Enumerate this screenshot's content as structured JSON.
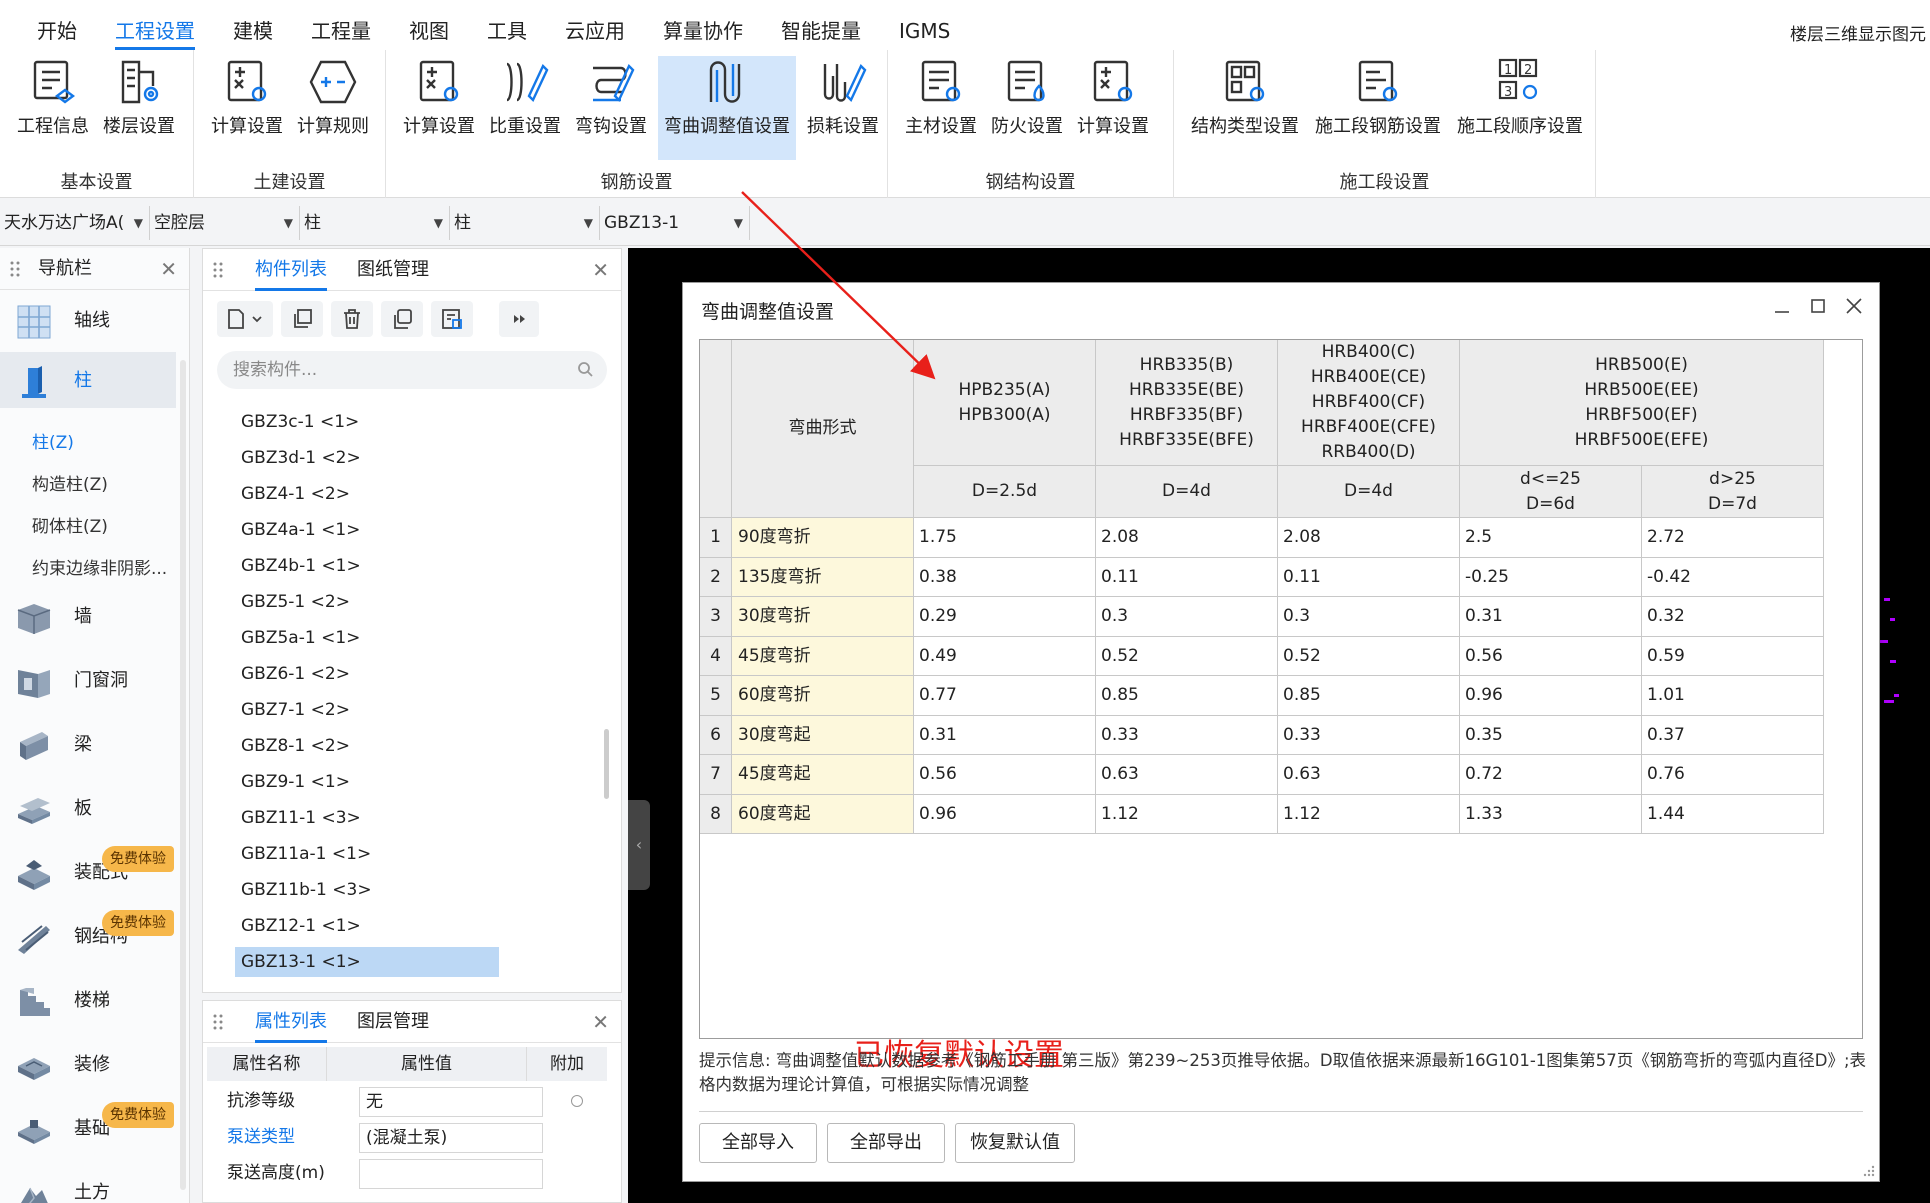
{
  "menubar": {
    "items": [
      "开始",
      "工程设置",
      "建模",
      "工程量",
      "视图",
      "工具",
      "云应用",
      "算量协作",
      "智能提量",
      "IGMS"
    ],
    "active_index": 1,
    "right_text": "楼层三维显示图元"
  },
  "ribbon": {
    "groups": {
      "basic": {
        "label": "基本设置",
        "btn0": "工程信息",
        "btn1": "楼层设置"
      },
      "civil": {
        "label": "土建设置",
        "btn0": "计算设置",
        "btn1": "计算规则"
      },
      "rebar": {
        "label": "钢筋设置",
        "btn0": "计算设置",
        "btn1": "比重设置",
        "btn2": "弯钩设置",
        "btn3": "弯曲调整值设置",
        "btn4": "损耗设置"
      },
      "steel": {
        "label": "钢结构设置",
        "btn0": "主材设置",
        "btn1": "防火设置",
        "btn2": "计算设置"
      },
      "stage": {
        "label": "施工段设置",
        "btn0": "结构类型设置",
        "btn1": "施工段钢筋设置",
        "btn2": "施工段顺序设置"
      }
    }
  },
  "selectors": {
    "project": "天水万达广场A(",
    "floor": "空腔层",
    "category": "柱",
    "type": "柱",
    "element": "GBZ13-1"
  },
  "nav": {
    "title": "导航栏",
    "items": {
      "axis": "轴线",
      "column": "柱",
      "wall": "墙",
      "opening": "门窗洞",
      "beam": "梁",
      "slab": "板",
      "prefab": "装配式",
      "steel": "钢结构",
      "stair": "楼梯",
      "decor": "装修",
      "foundation": "基础",
      "earth": "土方"
    },
    "subitems": [
      "柱(Z)",
      "构造柱(Z)",
      "砌体柱(Z)",
      "约束边缘非阴影..."
    ],
    "badge": "免费体验"
  },
  "components": {
    "tab_list": "构件列表",
    "tab_drawings": "图纸管理",
    "search_placeholder": "搜索构件...",
    "rows": [
      "GBZ3c-1 <1>",
      "GBZ3d-1 <2>",
      "GBZ4-1 <2>",
      "GBZ4a-1 <1>",
      "GBZ4b-1 <1>",
      "GBZ5-1 <2>",
      "GBZ5a-1 <1>",
      "GBZ6-1 <2>",
      "GBZ7-1 <2>",
      "GBZ8-1 <2>",
      "GBZ9-1 <1>",
      "GBZ11-1 <3>",
      "GBZ11a-1 <1>",
      "GBZ11b-1 <3>",
      "GBZ12-1 <1>",
      "GBZ13-1 <1>"
    ],
    "selected_index": 15
  },
  "properties": {
    "tab_list": "属性列表",
    "tab_layers": "图层管理",
    "col_name": "属性名称",
    "col_value": "属性值",
    "col_extra": "附加",
    "rows": [
      {
        "name": "抗渗等级",
        "value": "无"
      },
      {
        "name": "泵送类型",
        "value": "(混凝土泵)"
      },
      {
        "name": "泵送高度(m)",
        "value": ""
      }
    ]
  },
  "dialog": {
    "title": "弯曲调整值设置",
    "header": {
      "shape": "弯曲形式",
      "g1": [
        "HPB235(A)",
        "HPB300(A)"
      ],
      "g2": [
        "HRB335(B)",
        "HRB335E(BE)",
        "HRBF335(BF)",
        "HRBF335E(BFE)"
      ],
      "g3": [
        "HRB400(C)",
        "HRB400E(CE)",
        "HRBF400(CF)",
        "HRBF400E(CFE)",
        "RRB400(D)"
      ],
      "g4": [
        "HRB500(E)",
        "HRB500E(EE)",
        "HRBF500(EF)",
        "HRBF500E(EFE)"
      ],
      "d1": [
        "D=2.5d"
      ],
      "d2": [
        "D=4d"
      ],
      "d3": [
        "D=4d"
      ],
      "d4a": [
        "d<=25",
        "D=6d"
      ],
      "d4b": [
        "d>25",
        "D=7d"
      ]
    },
    "rows": [
      {
        "no": "1",
        "name": "90度弯折",
        "v": [
          "1.75",
          "2.08",
          "2.08",
          "2.5",
          "2.72"
        ]
      },
      {
        "no": "2",
        "name": "135度弯折",
        "v": [
          "0.38",
          "0.11",
          "0.11",
          "-0.25",
          "-0.42"
        ]
      },
      {
        "no": "3",
        "name": "30度弯折",
        "v": [
          "0.29",
          "0.3",
          "0.3",
          "0.31",
          "0.32"
        ]
      },
      {
        "no": "4",
        "name": "45度弯折",
        "v": [
          "0.49",
          "0.52",
          "0.52",
          "0.56",
          "0.59"
        ]
      },
      {
        "no": "5",
        "name": "60度弯折",
        "v": [
          "0.77",
          "0.85",
          "0.85",
          "0.96",
          "1.01"
        ]
      },
      {
        "no": "6",
        "name": "30度弯起",
        "v": [
          "0.31",
          "0.33",
          "0.33",
          "0.35",
          "0.37"
        ]
      },
      {
        "no": "7",
        "name": "45度弯起",
        "v": [
          "0.56",
          "0.63",
          "0.63",
          "0.72",
          "0.76"
        ]
      },
      {
        "no": "8",
        "name": "60度弯起",
        "v": [
          "0.96",
          "1.12",
          "1.12",
          "1.33",
          "1.44"
        ]
      }
    ],
    "restored_message": "已恢复默认设置",
    "tip": "提示信息: 弯曲调整值默认数据参考《钢筋工手册 第三版》第239~253页推导依据。D取值依据来源最新16G101-1图集第57页《钢筋弯折的弯弧内直径D》;表格内数据为理论计算值，可根据实际情况调整",
    "buttons": {
      "import": "全部导入",
      "export": "全部导出",
      "restore": "恢复默认值"
    }
  },
  "colors": {
    "accent": "#1478e8",
    "restored": "#e8201a",
    "arrow": "#e8201a",
    "name_cell": "#fdf8dc",
    "badge": "#f6b74a"
  }
}
